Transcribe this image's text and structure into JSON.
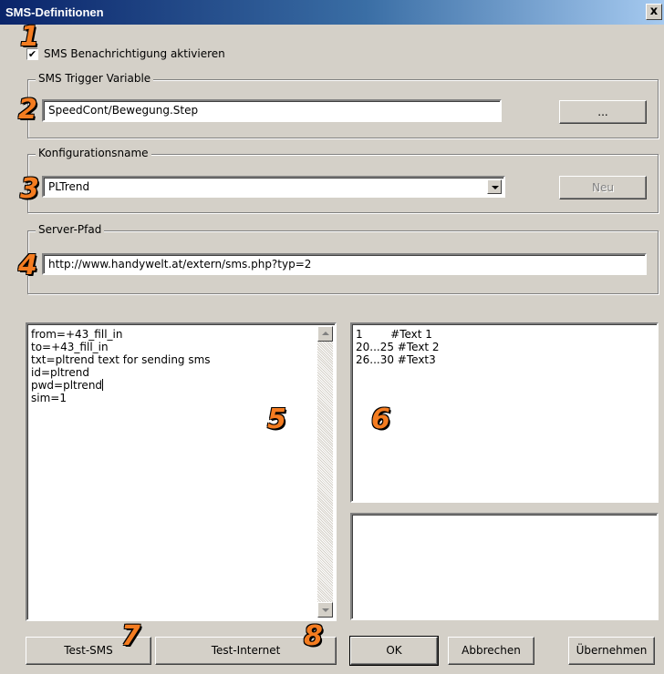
{
  "window": {
    "title": "SMS-Definitionen",
    "close_label": "x"
  },
  "sms_enable": {
    "label": "SMS Benachrichtigung aktivieren",
    "checked": true,
    "check_glyph": "✔"
  },
  "trigger": {
    "group_label": "SMS Trigger Variable",
    "value": "SpeedCont/Bewegung.Step",
    "browse_label": "..."
  },
  "config": {
    "group_label": "Konfigurationsname",
    "value": "PLTrend",
    "new_label": "Neu",
    "new_enabled": false
  },
  "server": {
    "group_label": "Server-Pfad",
    "value": "http://www.handywelt.at/extern/sms.php?typ=2"
  },
  "params_text": {
    "lines": [
      "from=+43_fill_in",
      "to=+43_fill_in",
      "txt=pltrend text for sending sms",
      "id=pltrend",
      "pwd=pltrend",
      "sim=1"
    ]
  },
  "text_mapping": {
    "lines": [
      "1        #Text 1",
      "20...25 #Text 2",
      "26...30 #Text3"
    ]
  },
  "buttons": {
    "test_sms": "Test-SMS",
    "test_internet": "Test-Internet",
    "ok": "OK",
    "cancel": "Abbrechen",
    "apply": "Übernehmen"
  },
  "callouts": [
    "1",
    "2",
    "3",
    "4",
    "5",
    "6",
    "7",
    "8"
  ],
  "colors": {
    "dialog_bg": "#d4d0c8",
    "titlebar_start": "#0a246a",
    "titlebar_end": "#a6caf0",
    "callout": "#f47c20"
  }
}
